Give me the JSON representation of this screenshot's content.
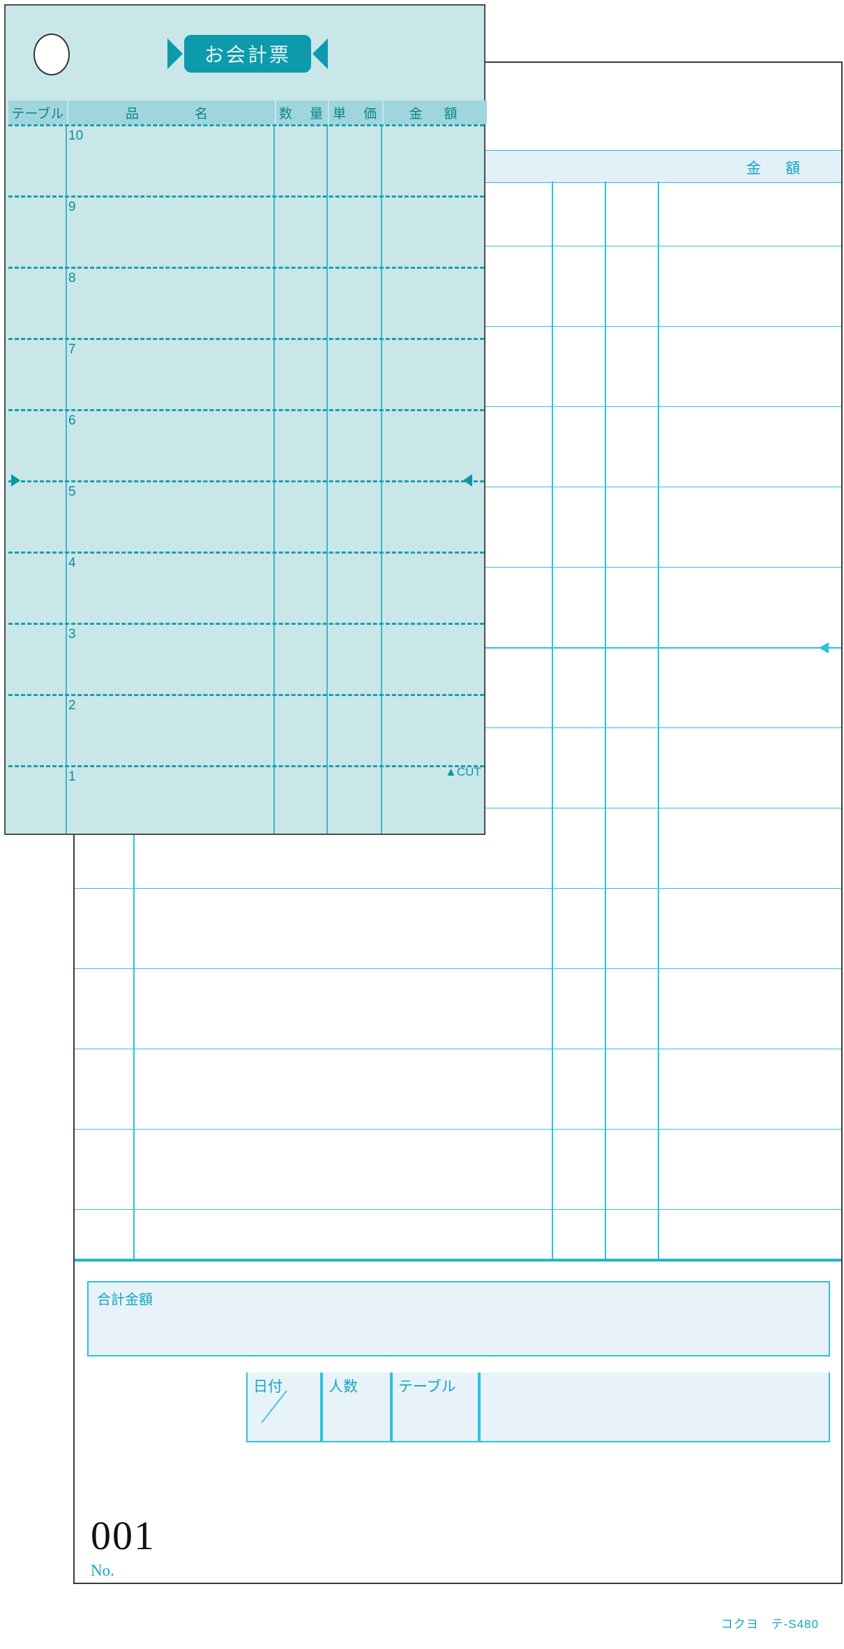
{
  "document": {
    "title": "お会計票",
    "brand": "コクヨ　テ-S480",
    "doc_number": "001",
    "doc_number_label": "No.",
    "cut_mark": "▲CUT"
  },
  "front_sheet": {
    "columns": [
      {
        "label": "テーブル"
      },
      {
        "label": "品　　名"
      },
      {
        "label": "数　量"
      },
      {
        "label": "単　価"
      },
      {
        "label": "金　額"
      }
    ],
    "row_numbers": [
      "10",
      "9",
      "8",
      "7",
      "6",
      "5",
      "4",
      "3",
      "2",
      "1"
    ]
  },
  "back_sheet": {
    "header_label": "金　額"
  },
  "summary": {
    "total_label": "合計金額",
    "fields": [
      {
        "label": "日付"
      },
      {
        "label": "人数"
      },
      {
        "label": "テーブル"
      },
      {
        "label": ""
      }
    ]
  },
  "colors": {
    "mint_paper": "#c9e7e8",
    "teal_dark": "#0e9aad",
    "teal_header": "#9fd6dd",
    "cyan_line": "#29c2e0",
    "pale_blue": "#e7f3f8",
    "text_teal": "#13a5c4"
  }
}
